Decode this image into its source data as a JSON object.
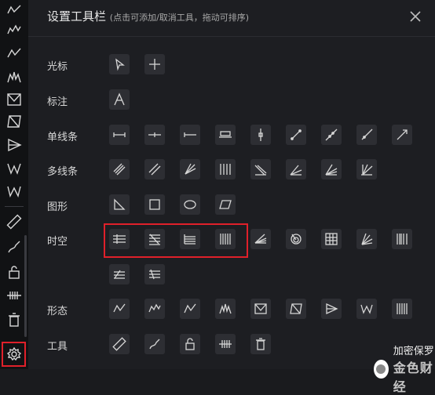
{
  "panel": {
    "title": "设置工具栏",
    "hint": "(点击可添加/取消工具，拖动可排序)"
  },
  "rows": [
    {
      "label": "光标",
      "tools": [
        "arrow-cursor-icon",
        "crosshair-icon"
      ]
    },
    {
      "label": "标注",
      "tools": [
        "text-label-icon"
      ]
    },
    {
      "label": "单线条",
      "tools": [
        "horizontal-segment-icon",
        "horizontal-ray-icon",
        "horizontal-line-left-icon",
        "price-label-icon",
        "vertical-line-icon",
        "trend-line-icon",
        "extended-line-icon",
        "ray-line-icon",
        "arrow-line-icon"
      ]
    },
    {
      "label": "多线条",
      "tools": [
        "parallel-channel-icon",
        "parallel-lines-icon",
        "fork-lines-icon",
        "vertical-bars-icon",
        "regression-icon",
        "angle-fan-icon",
        "gann-fan-icon",
        "fib-fan-icon"
      ]
    },
    {
      "label": "图形",
      "tools": [
        "triangle-icon",
        "rectangle-icon",
        "ellipse-icon",
        "parallelogram-icon"
      ]
    },
    {
      "label": "时空",
      "tools": [
        "fib-retracement-icon",
        "fib-extension-icon",
        "fib-channel-icon",
        "fib-time-zone-icon",
        "fib-speed-fan-icon",
        "fib-spiral-icon",
        "gann-box-icon",
        "fib-arc-icon",
        "time-cycles-icon",
        "fib-time-extension-icon",
        "fib-time-ratio-icon"
      ]
    },
    {
      "label": "形态",
      "tools": [
        "wave-abc-icon",
        "wave-five-icon",
        "wave-123-icon",
        "three-peaks-icon",
        "xabcd-pattern-icon",
        "abcd-pattern-icon",
        "triangle-pattern-icon",
        "w-pattern-icon",
        "head-shoulders-icon"
      ]
    },
    {
      "label": "工具",
      "tools": [
        "ruler-icon",
        "brush-icon",
        "lock-icon",
        "hide-icon",
        "trash-icon"
      ]
    }
  ],
  "watermark": {
    "text": "加密保罗",
    "logo": "金色财经"
  }
}
